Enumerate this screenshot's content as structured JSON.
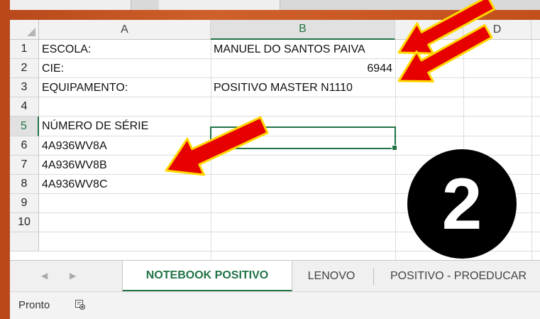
{
  "columns": [
    "A",
    "B",
    "",
    "D"
  ],
  "rows": [
    "1",
    "2",
    "3",
    "4",
    "5",
    "6",
    "7",
    "8",
    "9",
    "10"
  ],
  "cells": {
    "a1": "ESCOLA:",
    "b1": "MANUEL DO SANTOS PAIVA",
    "a2": "CIE:",
    "b2": "6944",
    "a3": "EQUIPAMENTO:",
    "b3": "POSITIVO MASTER N1110",
    "a5": "NÚMERO DE SÉRIE",
    "a6": "4A936WV8A",
    "a7": "4A936WV8B",
    "a8": "4A936WV8C"
  },
  "tabs": [
    "NOTEBOOK POSITIVO",
    "LENOVO",
    "POSITIVO - PROEDUCAR"
  ],
  "active_tab": "NOTEBOOK POSITIVO",
  "status": "Pronto",
  "badge_number": "2",
  "colors": {
    "accent": "#217346",
    "arrow": "#e60000",
    "arrow_outline": "#ffd800",
    "background": "#c4521e"
  },
  "icons": [
    "select-all-triangle-icon",
    "scroll-left-icon",
    "scroll-right-icon",
    "macro-record-icon"
  ]
}
